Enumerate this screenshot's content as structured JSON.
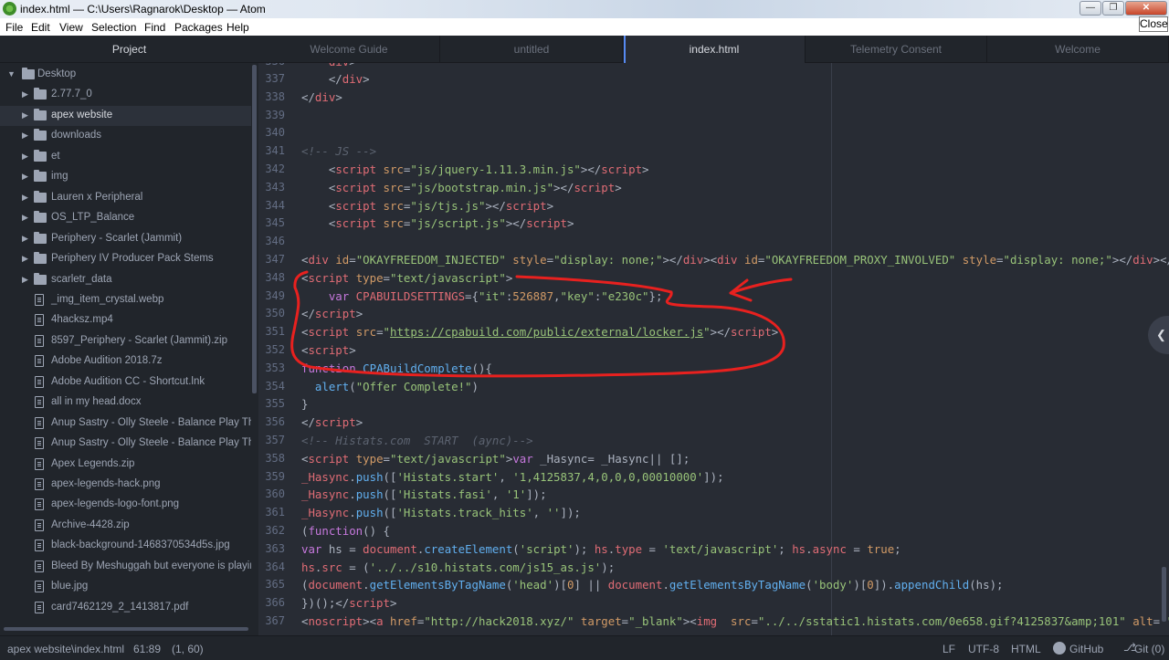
{
  "window": {
    "title": "index.html — C:\\Users\\Ragnarok\\Desktop — Atom",
    "min_glyph": "—",
    "max_glyph": "❐",
    "close_glyph": "✕",
    "close_tooltip": "Close"
  },
  "menu": [
    "File",
    "Edit",
    "View",
    "Selection",
    "Find",
    "Packages",
    "Help"
  ],
  "sidebar": {
    "title": "Project",
    "root": "Desktop",
    "items": [
      {
        "label": "2.77.7_0",
        "type": "folder"
      },
      {
        "label": "apex website",
        "type": "folder",
        "selected": true
      },
      {
        "label": "downloads",
        "type": "folder"
      },
      {
        "label": "et",
        "type": "folder"
      },
      {
        "label": "img",
        "type": "folder"
      },
      {
        "label": "Lauren x Peripheral",
        "type": "folder"
      },
      {
        "label": "OS_LTP_Balance",
        "type": "folder"
      },
      {
        "label": "Periphery - Scarlet (Jammit)",
        "type": "folder"
      },
      {
        "label": "Periphery IV Producer Pack Stems",
        "type": "folder"
      },
      {
        "label": "scarletr_data",
        "type": "folder"
      },
      {
        "label": "_img_item_crystal.webp",
        "type": "file"
      },
      {
        "label": "4hacksz.mp4",
        "type": "file"
      },
      {
        "label": "8597_Periphery - Scarlet (Jammit).zip",
        "type": "file"
      },
      {
        "label": "Adobe Audition 2018.7z",
        "type": "file"
      },
      {
        "label": "Adobe Audition CC - Shortcut.lnk",
        "type": "file"
      },
      {
        "label": "all in my head.docx",
        "type": "file"
      },
      {
        "label": "Anup Sastry - Olly Steele - Balance Play Thr",
        "type": "file"
      },
      {
        "label": "Anup Sastry - Olly Steele - Balance Play Thr",
        "type": "file"
      },
      {
        "label": "Apex Legends.zip",
        "type": "file"
      },
      {
        "label": "apex-legends-hack.png",
        "type": "file"
      },
      {
        "label": "apex-legends-logo-font.png",
        "type": "file"
      },
      {
        "label": "Archive-4428.zip",
        "type": "file"
      },
      {
        "label": "black-background-1468370534d5s.jpg",
        "type": "file"
      },
      {
        "label": "Bleed By Meshuggah but everyone is playin",
        "type": "file"
      },
      {
        "label": "blue.jpg",
        "type": "file"
      },
      {
        "label": "card7462129_2_1413817.pdf",
        "type": "file"
      }
    ]
  },
  "tabs": [
    {
      "label": "Welcome Guide",
      "active": false
    },
    {
      "label": "untitled",
      "active": false
    },
    {
      "label": "index.html",
      "active": true
    },
    {
      "label": "Telemetry Consent",
      "active": false
    },
    {
      "label": "Welcome",
      "active": false
    }
  ],
  "editor": {
    "partial_top_line": "336",
    "lines": [
      {
        "n": "337",
        "tokens": [
          [
            "p",
            "    </"
          ],
          [
            "t",
            "div"
          ],
          [
            "p",
            ">"
          ]
        ]
      },
      {
        "n": "338",
        "tokens": [
          [
            "p",
            "</"
          ],
          [
            "t",
            "div"
          ],
          [
            "p",
            ">"
          ]
        ]
      },
      {
        "n": "339",
        "tokens": []
      },
      {
        "n": "340",
        "tokens": []
      },
      {
        "n": "341",
        "tokens": [
          [
            "c",
            "<!-- JS -->"
          ]
        ]
      },
      {
        "n": "342",
        "tokens": [
          [
            "p",
            "    <"
          ],
          [
            "t",
            "script"
          ],
          [
            "a",
            " src"
          ],
          [
            "p",
            "="
          ],
          [
            "s",
            "\"js/jquery-1.11.3.min.js\""
          ],
          [
            "p",
            "></"
          ],
          [
            "t",
            "script"
          ],
          [
            "p",
            ">"
          ]
        ]
      },
      {
        "n": "343",
        "tokens": [
          [
            "p",
            "    <"
          ],
          [
            "t",
            "script"
          ],
          [
            "a",
            " src"
          ],
          [
            "p",
            "="
          ],
          [
            "s",
            "\"js/bootstrap.min.js\""
          ],
          [
            "p",
            "></"
          ],
          [
            "t",
            "script"
          ],
          [
            "p",
            ">"
          ]
        ]
      },
      {
        "n": "344",
        "tokens": [
          [
            "p",
            "    <"
          ],
          [
            "t",
            "script"
          ],
          [
            "a",
            " src"
          ],
          [
            "p",
            "="
          ],
          [
            "s",
            "\"js/tjs.js\""
          ],
          [
            "p",
            "></"
          ],
          [
            "t",
            "script"
          ],
          [
            "p",
            ">"
          ]
        ]
      },
      {
        "n": "345",
        "tokens": [
          [
            "p",
            "    <"
          ],
          [
            "t",
            "script"
          ],
          [
            "a",
            " src"
          ],
          [
            "p",
            "="
          ],
          [
            "s",
            "\"js/script.js\""
          ],
          [
            "p",
            "></"
          ],
          [
            "t",
            "script"
          ],
          [
            "p",
            ">"
          ]
        ]
      },
      {
        "n": "346",
        "tokens": []
      },
      {
        "n": "347",
        "tokens": [
          [
            "p",
            "<"
          ],
          [
            "t",
            "div"
          ],
          [
            "a",
            " id"
          ],
          [
            "p",
            "="
          ],
          [
            "s",
            "\"OKAYFREEDOM_INJECTED\""
          ],
          [
            "a",
            " style"
          ],
          [
            "p",
            "="
          ],
          [
            "s",
            "\"display: none;\""
          ],
          [
            "p",
            "></"
          ],
          [
            "t",
            "div"
          ],
          [
            "p",
            "><"
          ],
          [
            "t",
            "div"
          ],
          [
            "a",
            " id"
          ],
          [
            "p",
            "="
          ],
          [
            "s",
            "\"OKAYFREEDOM_PROXY_INVOLVED\""
          ],
          [
            "a",
            " style"
          ],
          [
            "p",
            "="
          ],
          [
            "s",
            "\"display: none;\""
          ],
          [
            "p",
            "></"
          ],
          [
            "t",
            "div"
          ],
          [
            "p",
            "></"
          ],
          [
            "t",
            "bo"
          ]
        ]
      },
      {
        "n": "348",
        "tokens": [
          [
            "p",
            "<"
          ],
          [
            "t",
            "script"
          ],
          [
            "a",
            " type"
          ],
          [
            "p",
            "="
          ],
          [
            "s",
            "\"text/javascript\""
          ],
          [
            "p",
            ">"
          ]
        ]
      },
      {
        "n": "349",
        "tokens": [
          [
            "k",
            "    var"
          ],
          [
            "v",
            " CPABUILDSETTINGS"
          ],
          [
            "p",
            "={"
          ],
          [
            "s",
            "\"it\""
          ],
          [
            "p",
            ":"
          ],
          [
            "a",
            "526887"
          ],
          [
            "p",
            ","
          ],
          [
            "s",
            "\"key\""
          ],
          [
            "p",
            ":"
          ],
          [
            "s",
            "\"e230c\""
          ],
          [
            "p",
            "};"
          ]
        ]
      },
      {
        "n": "350",
        "tokens": [
          [
            "p",
            "</"
          ],
          [
            "t",
            "script"
          ],
          [
            "p",
            ">"
          ]
        ]
      },
      {
        "n": "351",
        "tokens": [
          [
            "p",
            "<"
          ],
          [
            "t",
            "script"
          ],
          [
            "a",
            " src"
          ],
          [
            "p",
            "="
          ],
          [
            "s",
            "\""
          ],
          [
            "u",
            "https://cpabuild.com/public/external/locker.js"
          ],
          [
            "s",
            "\""
          ],
          [
            "p",
            "></"
          ],
          [
            "t",
            "script"
          ],
          [
            "p",
            ">"
          ]
        ]
      },
      {
        "n": "352",
        "tokens": [
          [
            "p",
            "<"
          ],
          [
            "t",
            "script"
          ],
          [
            "p",
            ">"
          ]
        ]
      },
      {
        "n": "353",
        "tokens": [
          [
            "k",
            "function"
          ],
          [
            "f",
            " CPABuildComplete"
          ],
          [
            "p",
            "(){"
          ]
        ]
      },
      {
        "n": "354",
        "tokens": [
          [
            "f",
            "  alert"
          ],
          [
            "p",
            "("
          ],
          [
            "s",
            "\"Offer Complete!\""
          ],
          [
            "p",
            ")"
          ]
        ]
      },
      {
        "n": "355",
        "tokens": [
          [
            "p",
            "}"
          ]
        ]
      },
      {
        "n": "356",
        "tokens": [
          [
            "p",
            "</"
          ],
          [
            "t",
            "script"
          ],
          [
            "p",
            ">"
          ]
        ]
      },
      {
        "n": "357",
        "tokens": [
          [
            "c",
            "<!-- Histats.com  START  (aync)-->"
          ]
        ]
      },
      {
        "n": "358",
        "tokens": [
          [
            "p",
            "<"
          ],
          [
            "t",
            "script"
          ],
          [
            "a",
            " type"
          ],
          [
            "p",
            "="
          ],
          [
            "s",
            "\"text/javascript\""
          ],
          [
            "p",
            ">"
          ],
          [
            "k",
            "var"
          ],
          [
            "p",
            " _Hasync= _Hasync|| [];"
          ]
        ]
      },
      {
        "n": "359",
        "tokens": [
          [
            "v",
            "_Hasync"
          ],
          [
            "p",
            "."
          ],
          [
            "f",
            "push"
          ],
          [
            "p",
            "(["
          ],
          [
            "s",
            "'Histats.start'"
          ],
          [
            "p",
            ", "
          ],
          [
            "s",
            "'1,4125837,4,0,0,0,00010000'"
          ],
          [
            "p",
            "]);"
          ]
        ]
      },
      {
        "n": "360",
        "tokens": [
          [
            "v",
            "_Hasync"
          ],
          [
            "p",
            "."
          ],
          [
            "f",
            "push"
          ],
          [
            "p",
            "(["
          ],
          [
            "s",
            "'Histats.fasi'"
          ],
          [
            "p",
            ", "
          ],
          [
            "s",
            "'1'"
          ],
          [
            "p",
            "]);"
          ]
        ]
      },
      {
        "n": "361",
        "tokens": [
          [
            "v",
            "_Hasync"
          ],
          [
            "p",
            "."
          ],
          [
            "f",
            "push"
          ],
          [
            "p",
            "(["
          ],
          [
            "s",
            "'Histats.track_hits'"
          ],
          [
            "p",
            ", "
          ],
          [
            "s",
            "''"
          ],
          [
            "p",
            "]);"
          ]
        ]
      },
      {
        "n": "362",
        "tokens": [
          [
            "p",
            "("
          ],
          [
            "k",
            "function"
          ],
          [
            "p",
            "() {"
          ]
        ]
      },
      {
        "n": "363",
        "tokens": [
          [
            "k",
            "var"
          ],
          [
            "p",
            " hs = "
          ],
          [
            "v",
            "document"
          ],
          [
            "p",
            "."
          ],
          [
            "f",
            "createElement"
          ],
          [
            "p",
            "("
          ],
          [
            "s",
            "'script'"
          ],
          [
            "p",
            "); "
          ],
          [
            "v",
            "hs"
          ],
          [
            "p",
            "."
          ],
          [
            "v",
            "type"
          ],
          [
            "p",
            " = "
          ],
          [
            "s",
            "'text/javascript'"
          ],
          [
            "p",
            "; "
          ],
          [
            "v",
            "hs"
          ],
          [
            "p",
            "."
          ],
          [
            "v",
            "async"
          ],
          [
            "p",
            " = "
          ],
          [
            "a",
            "true"
          ],
          [
            "p",
            ";"
          ]
        ]
      },
      {
        "n": "364",
        "tokens": [
          [
            "v",
            "hs"
          ],
          [
            "p",
            "."
          ],
          [
            "v",
            "src"
          ],
          [
            "p",
            " = ("
          ],
          [
            "s",
            "'../../s10.histats.com/js15_as.js'"
          ],
          [
            "p",
            ");"
          ]
        ]
      },
      {
        "n": "365",
        "tokens": [
          [
            "p",
            "("
          ],
          [
            "v",
            "document"
          ],
          [
            "p",
            "."
          ],
          [
            "f",
            "getElementsByTagName"
          ],
          [
            "p",
            "("
          ],
          [
            "s",
            "'head'"
          ],
          [
            "p",
            ")["
          ],
          [
            "a",
            "0"
          ],
          [
            "p",
            "] || "
          ],
          [
            "v",
            "document"
          ],
          [
            "p",
            "."
          ],
          [
            "f",
            "getElementsByTagName"
          ],
          [
            "p",
            "("
          ],
          [
            "s",
            "'body'"
          ],
          [
            "p",
            ")["
          ],
          [
            "a",
            "0"
          ],
          [
            "p",
            "])."
          ],
          [
            "f",
            "appendChild"
          ],
          [
            "p",
            "(hs);"
          ]
        ]
      },
      {
        "n": "366",
        "tokens": [
          [
            "p",
            "})();</"
          ],
          [
            "t",
            "script"
          ],
          [
            "p",
            ">"
          ]
        ]
      },
      {
        "n": "367",
        "tokens": [
          [
            "p",
            "<"
          ],
          [
            "t",
            "noscript"
          ],
          [
            "p",
            "><"
          ],
          [
            "t",
            "a"
          ],
          [
            "a",
            " href"
          ],
          [
            "p",
            "="
          ],
          [
            "s",
            "\"http://hack2018.xyz/\""
          ],
          [
            "a",
            " target"
          ],
          [
            "p",
            "="
          ],
          [
            "s",
            "\"_blank\""
          ],
          [
            "p",
            "><"
          ],
          [
            "t",
            "img"
          ],
          [
            "a",
            "  src"
          ],
          [
            "p",
            "="
          ],
          [
            "s",
            "\"../../sstatic1.histats.com/0e658.gif?4125837&amp;101\""
          ],
          [
            "a",
            " alt"
          ],
          [
            "p",
            "="
          ],
          [
            "s",
            "\"\" b"
          ]
        ]
      }
    ]
  },
  "statusbar": {
    "path": "apex website\\index.html",
    "cursor": "61:89",
    "selection": "(1, 60)",
    "line_ending": "LF",
    "encoding": "UTF-8",
    "grammar": "HTML",
    "github": "GitHub",
    "git": "Git (0)"
  },
  "annotation_color": "#e8211f"
}
